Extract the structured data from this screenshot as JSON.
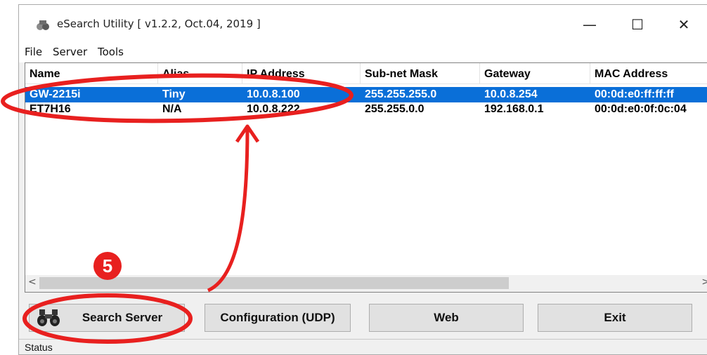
{
  "window": {
    "title": "eSearch Utility [ v1.2.2, Oct.04, 2019 ]",
    "controls": {
      "minimize": "—",
      "maximize": "☐",
      "close": "✕"
    }
  },
  "menu": [
    "File",
    "Server",
    "Tools"
  ],
  "table": {
    "columns": [
      "Name",
      "Alias",
      "IP Address",
      "Sub-net Mask",
      "Gateway",
      "MAC Address"
    ],
    "rows": [
      [
        "GW-2215i",
        "Tiny",
        "10.0.8.100",
        "255.255.255.0",
        "10.0.8.254",
        "00:0d:e0:ff:ff:ff"
      ],
      [
        "ET7H16",
        "N/A",
        "10.0.8.222",
        "255.255.0.0",
        "192.168.0.1",
        "00:0d:e0:0f:0c:04"
      ]
    ],
    "selected_row": 0
  },
  "scrollbar": {
    "left": "<",
    "right": ">"
  },
  "buttons": {
    "search": "Search Server",
    "config": "Configuration (UDP)",
    "web": "Web",
    "exit": "Exit"
  },
  "status": "Status",
  "annotation": {
    "step": "5"
  },
  "colors": {
    "selection": "#0a6fd8",
    "annotation": "#e8201f"
  }
}
